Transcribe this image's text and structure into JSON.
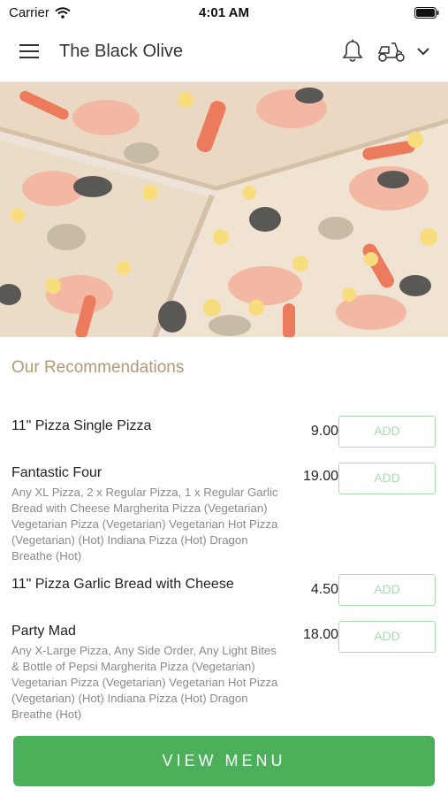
{
  "status_bar": {
    "carrier": "Carrier",
    "time": "4:01 AM"
  },
  "header": {
    "title": "The Black Olive"
  },
  "section_title": "Our Recommendations",
  "items": [
    {
      "name": "11\" Pizza Single Pizza",
      "description": "",
      "price": "9.00",
      "add_label": "ADD"
    },
    {
      "name": "Fantastic Four",
      "description": "Any XL Pizza, 2 x Regular Pizza, 1 x Regular Garlic Bread with Cheese   Margherita Pizza (Vegetarian)  Vegetarian Pizza (Vegetarian)  Vegetarian Hot Pizza (Vegetarian) (Hot)  Indiana Pizza (Hot)  Dragon Breathe (Hot)",
      "price": "19.00",
      "add_label": "ADD"
    },
    {
      "name": "11\" Pizza Garlic Bread with Cheese",
      "description": "",
      "price": "4.50",
      "add_label": "ADD"
    },
    {
      "name": "Party Mad",
      "description": "Any X-Large Pizza, Any Side Order, Any Light Bites & Bottle of Pepsi  Margherita Pizza (Vegetarian)  Vegetarian Pizza (Vegetarian)  Vegetarian Hot Pizza (Vegetarian) (Hot)  Indiana Pizza (Hot)  Dragon Breathe (Hot)",
      "price": "18.00",
      "add_label": "ADD"
    }
  ],
  "view_menu_label": "VIEW MENU",
  "colors": {
    "accent": "#4caf5a",
    "section_title": "#b39a74",
    "add_border": "#a8dcb0"
  },
  "icons": [
    "wifi-icon",
    "battery-icon",
    "hamburger-menu-icon",
    "bell-icon",
    "scooter-icon",
    "chevron-down-icon"
  ]
}
